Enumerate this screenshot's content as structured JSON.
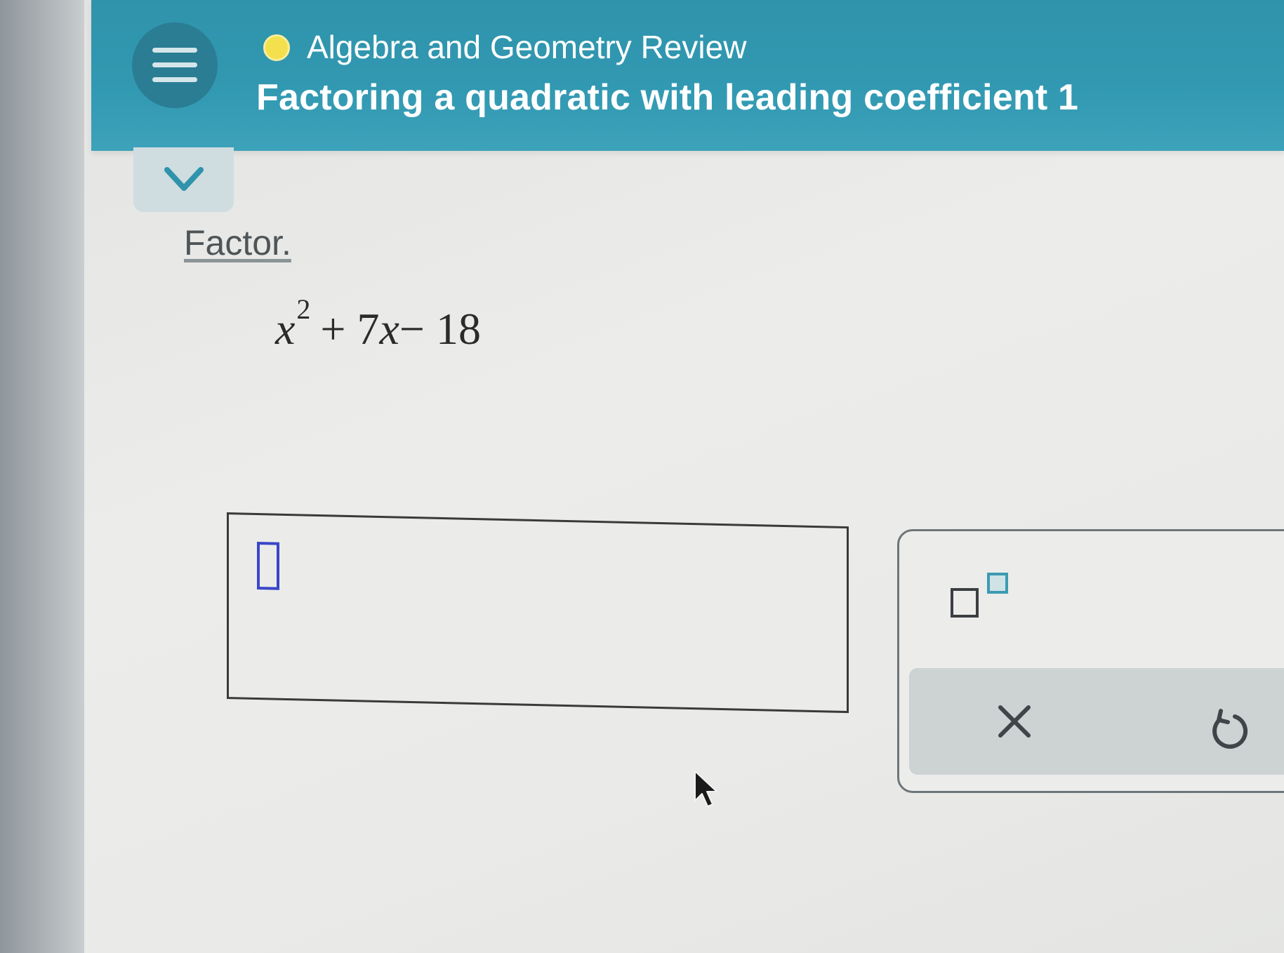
{
  "header": {
    "course_title": "Algebra and Geometry Review",
    "topic_title": "Factoring a quadratic with leading coefficient 1",
    "status_color": "#f4e04d",
    "bar_color": "#3299b2"
  },
  "question": {
    "instruction": "Factor.",
    "expression": {
      "variable": "x",
      "exponent": "2",
      "rest_terms": "+ 7",
      "linear_variable": "x",
      "constant_term": "− 18"
    }
  },
  "answer": {
    "value": "",
    "cursor_color": "#3946c9"
  },
  "keypad": {
    "exponent_key_icon": "superscript-template-icon",
    "clear_icon": "close-icon",
    "undo_icon": "undo-icon"
  }
}
